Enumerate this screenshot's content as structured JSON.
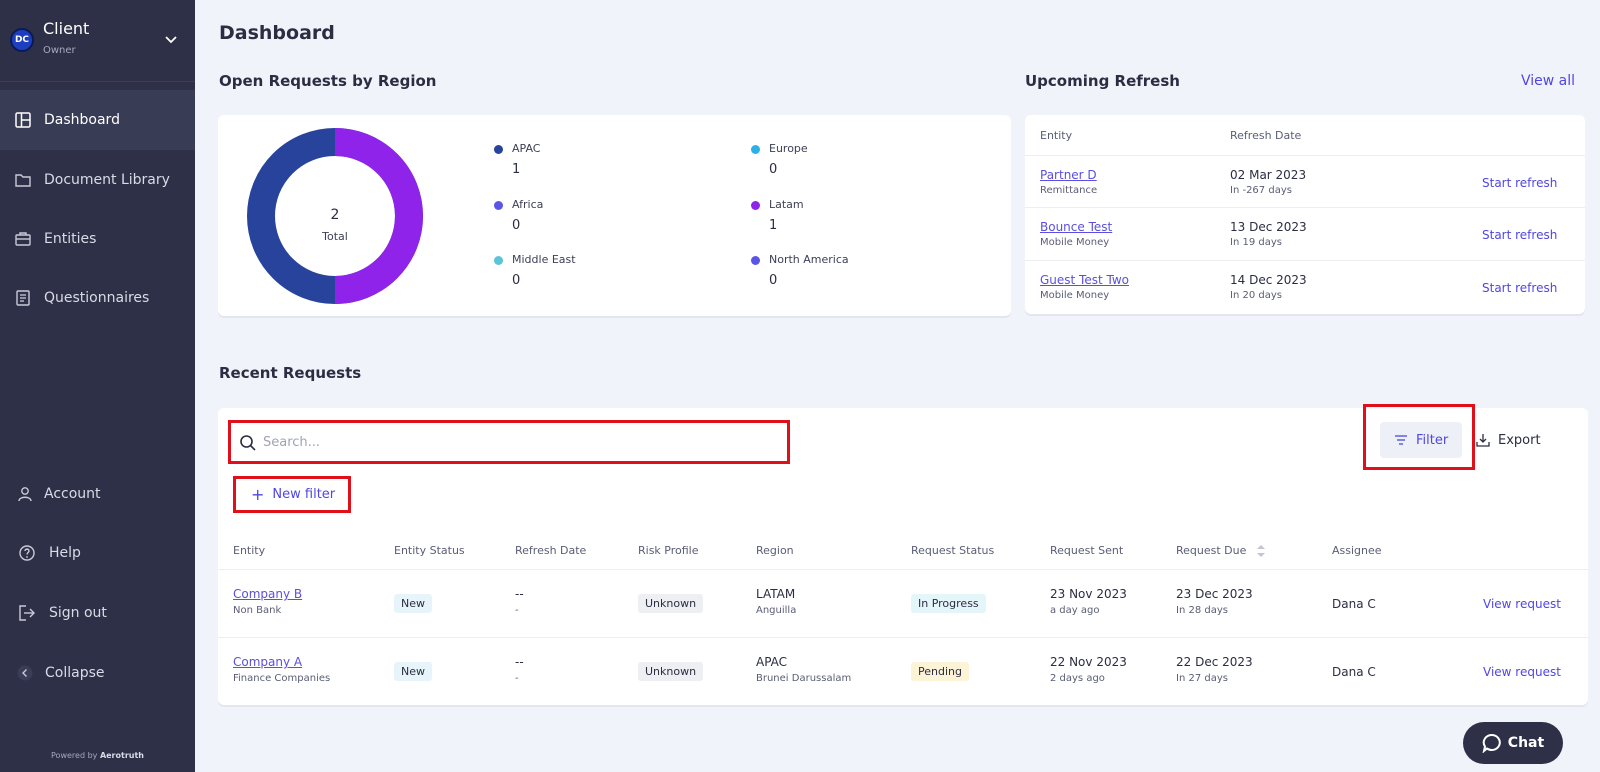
{
  "sidebar": {
    "org_logo": "DC",
    "org_name": "Client",
    "org_role": "Owner",
    "nav": [
      {
        "label": "Dashboard",
        "icon": "layout-icon"
      },
      {
        "label": "Document Library",
        "icon": "folder-icon"
      },
      {
        "label": "Entities",
        "icon": "briefcase-icon"
      },
      {
        "label": "Questionnaires",
        "icon": "document-icon"
      }
    ],
    "bottom": [
      {
        "label": "Account",
        "icon": "user-icon"
      },
      {
        "label": "Help",
        "icon": "help-icon"
      },
      {
        "label": "Sign out",
        "icon": "sign-out-icon"
      },
      {
        "label": "Collapse",
        "icon": "chevron-left-icon"
      }
    ],
    "powered_prefix": "Powered by",
    "powered_brand": "Aerotruth"
  },
  "main": {
    "title": "Dashboard",
    "regions": {
      "title": "Open Requests by Region",
      "total_value": "2",
      "total_label": "Total",
      "legend": [
        {
          "name": "APAC",
          "value": "1",
          "color": "#27439b"
        },
        {
          "name": "Europe",
          "value": "0",
          "color": "#2cb0e8"
        },
        {
          "name": "Africa",
          "value": "0",
          "color": "#5b55e6"
        },
        {
          "name": "Latam",
          "value": "1",
          "color": "#8f23ea"
        },
        {
          "name": "Middle East",
          "value": "0",
          "color": "#5bc4d8"
        },
        {
          "name": "North America",
          "value": "0",
          "color": "#5b55e6"
        }
      ]
    },
    "refresh": {
      "title": "Upcoming Refresh",
      "view_all": "View all",
      "col_entity": "Entity",
      "col_date": "Refresh Date",
      "rows": [
        {
          "entity": "Partner D",
          "type": "Remittance",
          "date": "02 Mar 2023",
          "due": "In -267 days",
          "action": "Start refresh"
        },
        {
          "entity": "Bounce Test",
          "type": "Mobile Money",
          "date": "13 Dec 2023",
          "due": "In 19 days",
          "action": "Start refresh"
        },
        {
          "entity": "Guest Test Two",
          "type": "Mobile Money",
          "date": "14 Dec 2023",
          "due": "In 20 days",
          "action": "Start refresh"
        }
      ]
    },
    "recent": {
      "title": "Recent Requests",
      "search_placeholder": "Search...",
      "new_filter": "New filter",
      "filter": "Filter",
      "export": "Export",
      "columns": [
        "Entity",
        "Entity Status",
        "Refresh Date",
        "Risk Profile",
        "Region",
        "Request Status",
        "Request Sent",
        "Request Due",
        "Assignee"
      ],
      "rows": [
        {
          "entity": "Company B",
          "entity_type": "Non Bank",
          "entity_status": "New",
          "refresh_date": "--",
          "refresh_sub": "-",
          "risk": "Unknown",
          "region": "LATAM",
          "country": "Anguilla",
          "status": "In Progress",
          "sent": "23 Nov 2023",
          "sent_ago": "a day ago",
          "due": "23 Dec 2023",
          "due_in": "In 28 days",
          "assignee": "Dana C",
          "action": "View request"
        },
        {
          "entity": "Company A",
          "entity_type": "Finance Companies",
          "entity_status": "New",
          "refresh_date": "--",
          "refresh_sub": "-",
          "risk": "Unknown",
          "region": "APAC",
          "country": "Brunei Darussalam",
          "status": "Pending",
          "sent": "22 Nov 2023",
          "sent_ago": "2 days ago",
          "due": "22 Dec 2023",
          "due_in": "In 27 days",
          "assignee": "Dana C",
          "action": "View request"
        }
      ]
    },
    "chat_label": "Chat"
  }
}
